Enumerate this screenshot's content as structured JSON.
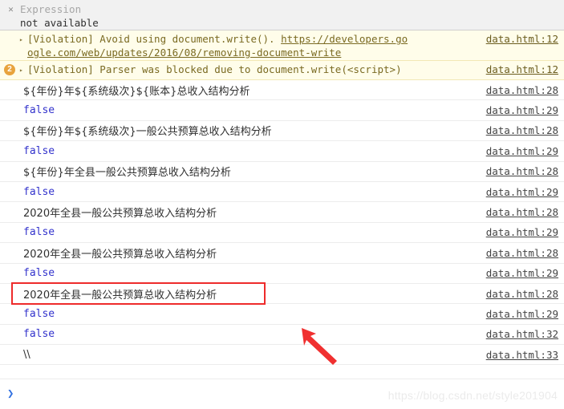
{
  "watch": {
    "close_icon": "close-icon",
    "label": "Expression",
    "value": "not available"
  },
  "violations": [
    {
      "badge": "",
      "disclosure": "▸",
      "text_before_link": "[Violation] Avoid using document.write(). ",
      "link_text": "https://developers.go",
      "wrapped_link": "ogle.com/web/updates/2016/08/removing-document-write",
      "source": "data.html:12"
    },
    {
      "badge": "2",
      "disclosure": "▸",
      "text_before_link": "[Violation] Parser was blocked due to document.write(<script>)",
      "link_text": "",
      "wrapped_link": "",
      "source": "data.html:12"
    }
  ],
  "logs": [
    {
      "message": "${年份}年${系统级次}${账本}总收入结构分析",
      "kind": "str",
      "source": "data.html:28"
    },
    {
      "message": "false",
      "kind": "bool",
      "source": "data.html:29"
    },
    {
      "message": "${年份}年${系统级次}一般公共预算总收入结构分析",
      "kind": "str",
      "source": "data.html:28"
    },
    {
      "message": "false",
      "kind": "bool",
      "source": "data.html:29"
    },
    {
      "message": "${年份}年全县一般公共预算总收入结构分析",
      "kind": "str",
      "source": "data.html:28"
    },
    {
      "message": "false",
      "kind": "bool",
      "source": "data.html:29"
    },
    {
      "message": "2020年全县一般公共预算总收入结构分析",
      "kind": "str",
      "source": "data.html:28"
    },
    {
      "message": "false",
      "kind": "bool",
      "source": "data.html:29"
    },
    {
      "message": "2020年全县一般公共预算总收入结构分析",
      "kind": "str",
      "source": "data.html:28"
    },
    {
      "message": "false",
      "kind": "bool",
      "source": "data.html:29"
    },
    {
      "message": "2020年全县一般公共预算总收入结构分析",
      "kind": "str",
      "source": "data.html:28",
      "highlighted": true
    },
    {
      "message": "false",
      "kind": "bool",
      "source": "data.html:29"
    },
    {
      "message": "false",
      "kind": "bool",
      "source": "data.html:32"
    },
    {
      "message": "\\\\",
      "kind": "str",
      "source": "data.html:33"
    }
  ],
  "annotations": {
    "highlight_color": "#ee2b2b",
    "arrow_color": "#f03030",
    "arrow_name": "red-pointer-arrow"
  },
  "prompt": {
    "caret": "❯",
    "placeholder": ""
  },
  "watermark": "https://blog.csdn.net/style201904"
}
